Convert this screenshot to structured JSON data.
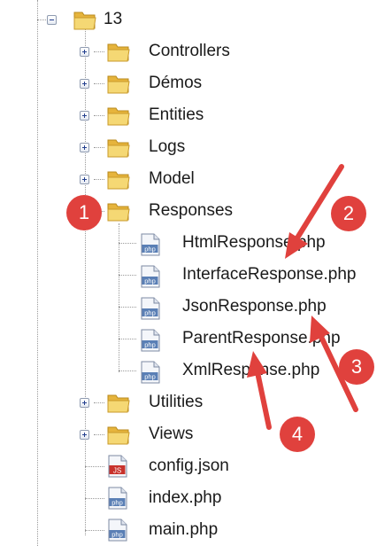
{
  "tree": {
    "root_folder": {
      "label": "13",
      "expanded": true,
      "icon": "folder-icon"
    },
    "items": [
      {
        "label": "Controllers",
        "type": "folder",
        "expanded": false
      },
      {
        "label": "Démos",
        "type": "folder",
        "expanded": false
      },
      {
        "label": "Entities",
        "type": "folder",
        "expanded": false
      },
      {
        "label": "Logs",
        "type": "folder",
        "expanded": false
      },
      {
        "label": "Model",
        "type": "folder",
        "expanded": false
      },
      {
        "label": "Responses",
        "type": "folder",
        "expanded": true
      },
      {
        "label": "Utilities",
        "type": "folder",
        "expanded": false
      },
      {
        "label": "Views",
        "type": "folder",
        "expanded": false
      },
      {
        "label": "config.json",
        "type": "file",
        "badge": "JS"
      },
      {
        "label": "index.php",
        "type": "file",
        "badge": "php"
      },
      {
        "label": "main.php",
        "type": "file",
        "badge": "php"
      }
    ],
    "responses_files": [
      {
        "label": "HtmlResponse.php",
        "badge": "php"
      },
      {
        "label": "InterfaceResponse.php",
        "badge": "php"
      },
      {
        "label": "JsonResponse.php",
        "badge": "php"
      },
      {
        "label": "ParentResponse.php",
        "badge": "php"
      },
      {
        "label": "XmlResponse.php",
        "badge": "php"
      }
    ]
  },
  "annotations": [
    {
      "number": "1"
    },
    {
      "number": "2"
    },
    {
      "number": "3"
    },
    {
      "number": "4"
    }
  ],
  "colors": {
    "annotation_red": "#e0413d",
    "folder_yellow": "#f2d36b",
    "php_icon_blue": "#5a7fb5",
    "js_icon_red": "#c8322c",
    "tree_line": "#9a9a9a"
  }
}
